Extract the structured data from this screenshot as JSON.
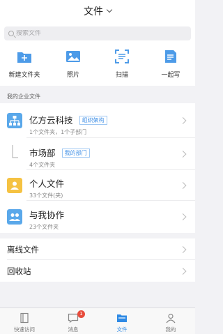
{
  "header": {
    "title": "文件"
  },
  "search": {
    "placeholder": "搜索文件"
  },
  "quick_actions": [
    {
      "label": "新建文件夹",
      "icon": "new-folder-icon"
    },
    {
      "label": "照片",
      "icon": "photo-icon"
    },
    {
      "label": "扫描",
      "icon": "scan-icon"
    },
    {
      "label": "一起写",
      "icon": "collab-write-icon"
    }
  ],
  "enterprise": {
    "section_label": "我的企业文件",
    "company": {
      "name": "亿方云科技",
      "tag": "组织架构",
      "sub": "1个文件夹，1个子部门"
    },
    "department": {
      "name": "市场部",
      "tag": "我的部门",
      "sub": "4个文件夹"
    },
    "personal": {
      "name": "个人文件",
      "sub": "33个文件(夹)"
    },
    "shared": {
      "name": "与我协作",
      "sub": "23个文件夹"
    }
  },
  "misc": {
    "offline": "离线文件",
    "recycle": "回收站"
  },
  "tabs": [
    {
      "label": "快速访问",
      "icon": "quick-access-icon"
    },
    {
      "label": "消息",
      "icon": "message-icon",
      "badge": "1"
    },
    {
      "label": "文件",
      "icon": "files-icon",
      "active": true
    },
    {
      "label": "我的",
      "icon": "profile-icon"
    }
  ],
  "colors": {
    "accent": "#2f8ae5",
    "folder_yellow": "#f5c242",
    "folder_blue": "#5aa8ea",
    "badge": "#e74c3c"
  }
}
